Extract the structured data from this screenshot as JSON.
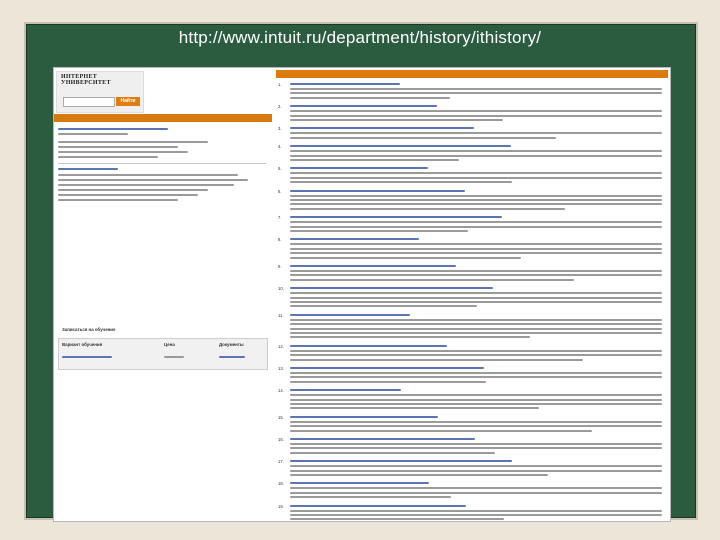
{
  "slide": {
    "caption": "http://www.intuit.ru/department/history/ithistory/"
  },
  "colors": {
    "board": "#2c5c40",
    "accent_orange": "#dc7b0c",
    "link_blue": "#1a3c8a"
  },
  "site": {
    "logo": "ИНТЕРНЕТ УНИВЕРСИТЕТ",
    "search_button": "Найти"
  },
  "sidebar": {
    "section_title": "Записаться на обучение",
    "columns": [
      "Вариант обучения",
      "Цена",
      "Документы"
    ]
  },
  "content": {
    "items": [
      {
        "num": "1.",
        "title": ""
      },
      {
        "num": "2.",
        "title": ""
      },
      {
        "num": "3.",
        "title": ""
      },
      {
        "num": "4.",
        "title": ""
      },
      {
        "num": "5.",
        "title": ""
      },
      {
        "num": "6.",
        "title": ""
      },
      {
        "num": "7.",
        "title": ""
      },
      {
        "num": "8.",
        "title": ""
      },
      {
        "num": "9.",
        "title": ""
      },
      {
        "num": "10.",
        "title": ""
      },
      {
        "num": "11.",
        "title": ""
      },
      {
        "num": "12.",
        "title": ""
      },
      {
        "num": "13.",
        "title": ""
      },
      {
        "num": "14.",
        "title": ""
      },
      {
        "num": "15.",
        "title": ""
      },
      {
        "num": "16.",
        "title": ""
      },
      {
        "num": "17.",
        "title": ""
      },
      {
        "num": "18.",
        "title": ""
      },
      {
        "num": "19.",
        "title": ""
      }
    ]
  }
}
